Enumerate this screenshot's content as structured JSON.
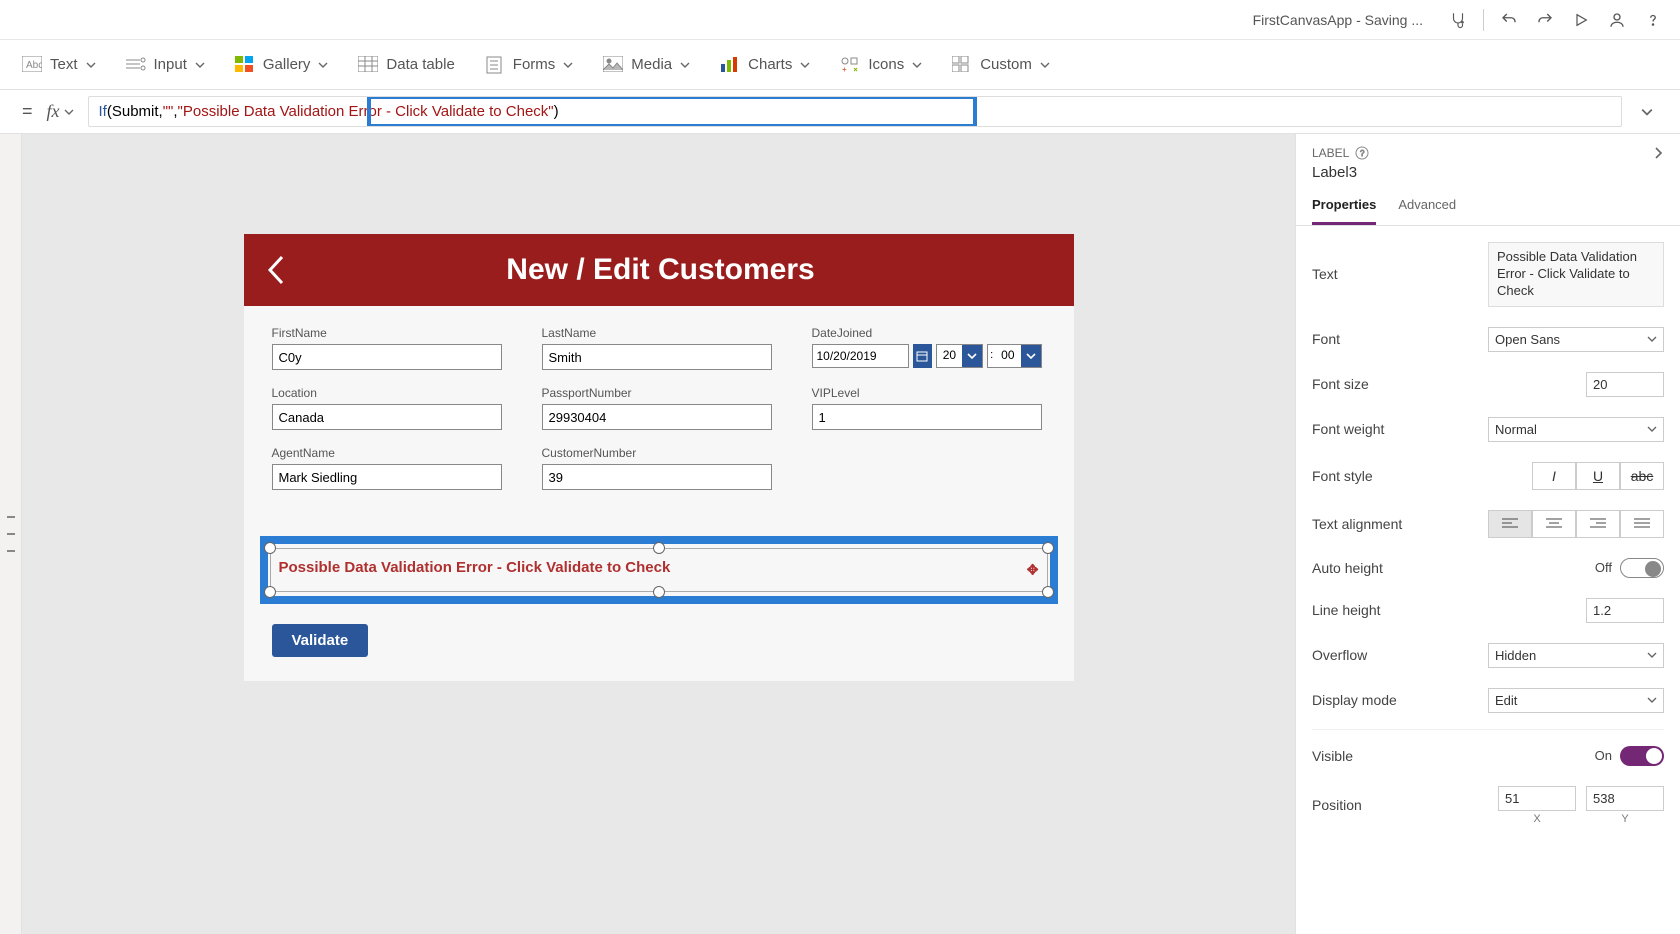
{
  "titlebar": {
    "title": "FirstCanvasApp - Saving ..."
  },
  "ribbon": {
    "text": "Text",
    "input": "Input",
    "gallery": "Gallery",
    "datatable": "Data table",
    "forms": "Forms",
    "media": "Media",
    "charts": "Charts",
    "icons": "Icons",
    "custom": "Custom"
  },
  "formula": {
    "pre1": "If",
    "pre2": "(Submit, ",
    "str1": "\"\"",
    "pre3": ", ",
    "str2": "\"Possible Data Validation Error - Click Validate to Check\"",
    "post": ")"
  },
  "canvas": {
    "header": "New / Edit Customers",
    "fields": {
      "firstname": {
        "label": "FirstName",
        "value": "C0y"
      },
      "lastname": {
        "label": "LastName",
        "value": "Smith"
      },
      "datejoined": {
        "label": "DateJoined",
        "value": "10/20/2019",
        "hour": "20",
        "minute": "00"
      },
      "location": {
        "label": "Location",
        "value": "Canada"
      },
      "passport": {
        "label": "PassportNumber",
        "value": "29930404"
      },
      "vip": {
        "label": "VIPLevel",
        "value": "1"
      },
      "agent": {
        "label": "AgentName",
        "value": "Mark Siedling"
      },
      "custnum": {
        "label": "CustomerNumber",
        "value": "39"
      }
    },
    "labelText": "Possible Data Validation Error - Click Validate to Check",
    "validate": "Validate"
  },
  "rp": {
    "type": "LABEL",
    "name": "Label3",
    "tabs": {
      "properties": "Properties",
      "advanced": "Advanced"
    },
    "props": {
      "text_label": "Text",
      "text_value": "Possible Data Validation Error - Click Validate to Check",
      "font_label": "Font",
      "font_value": "Open Sans",
      "fontsize_label": "Font size",
      "fontsize_value": "20",
      "fontweight_label": "Font weight",
      "fontweight_value": "Normal",
      "fontstyle_label": "Font style",
      "align_label": "Text alignment",
      "autoheight_label": "Auto height",
      "autoheight_state": "Off",
      "lineheight_label": "Line height",
      "lineheight_value": "1.2",
      "overflow_label": "Overflow",
      "overflow_value": "Hidden",
      "displaymode_label": "Display mode",
      "displaymode_value": "Edit",
      "visible_label": "Visible",
      "visible_state": "On",
      "position_label": "Position",
      "pos_x": "51",
      "pos_y": "538",
      "x_label": "X",
      "y_label": "Y"
    }
  }
}
